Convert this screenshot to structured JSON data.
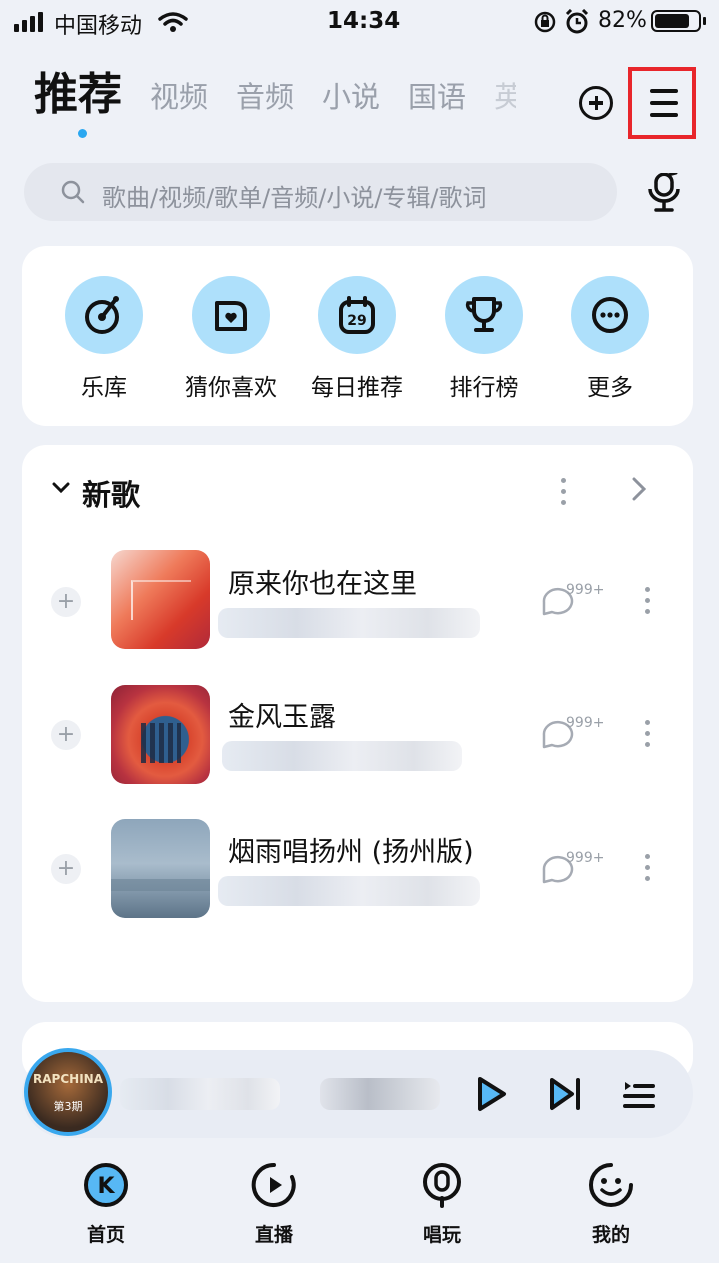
{
  "status_bar": {
    "carrier": "中国移动",
    "time": "14:34",
    "battery_percent": "82%"
  },
  "header": {
    "main_tab": "推荐",
    "tabs": [
      "视频",
      "音频",
      "小说",
      "国语",
      "英"
    ]
  },
  "search": {
    "placeholder": "歌曲/视频/歌单/音频/小说/专辑/歌词"
  },
  "quick_entries": [
    {
      "label": "乐库",
      "icon": "disc-icon"
    },
    {
      "label": "猜你喜欢",
      "icon": "heart-box-icon"
    },
    {
      "label": "每日推荐",
      "icon": "calendar-icon",
      "day": "29"
    },
    {
      "label": "排行榜",
      "icon": "trophy-icon"
    },
    {
      "label": "更多",
      "icon": "more-icon"
    }
  ],
  "new_songs": {
    "title": "新歌",
    "items": [
      {
        "title": "原来你也在这里",
        "comments": "999+",
        "cover_color": "#e0523a"
      },
      {
        "title": "金风玉露",
        "comments": "999+",
        "cover_color": "#c93d35"
      },
      {
        "title": "烟雨唱扬州 (扬州版)",
        "comments": "999+",
        "cover_color": "#8aa2b8"
      }
    ]
  },
  "player": {
    "cover_text": "RAPCHINA",
    "cover_subtext": "第3期"
  },
  "bottom_nav": [
    {
      "label": "首页",
      "icon": "k-icon",
      "active": true
    },
    {
      "label": "直播",
      "icon": "live-play-icon",
      "active": false
    },
    {
      "label": "唱玩",
      "icon": "mic-icon",
      "active": false
    },
    {
      "label": "我的",
      "icon": "smile-icon",
      "active": false
    }
  ],
  "colors": {
    "accent": "#2aa7f0",
    "circle_bg": "#aee0fb",
    "highlight_box": "#e8262b"
  }
}
